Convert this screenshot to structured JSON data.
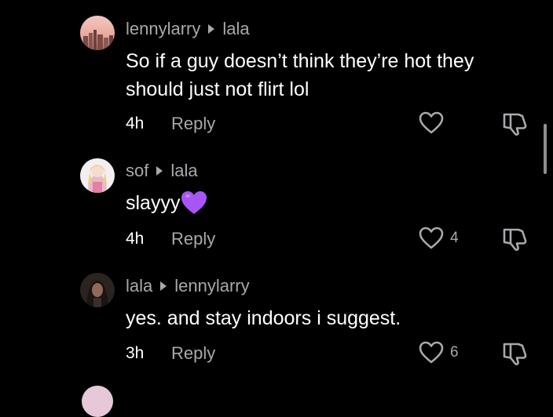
{
  "comments": [
    {
      "author": "lennylarry",
      "reply_to": "lala",
      "text_lines": [
        "So if a guy doesn’t think they’re hot they",
        "should just not flirt lol"
      ],
      "time": "4h",
      "reply_label": "Reply",
      "likes": "",
      "avatar_icon": "sunset-city-avatar"
    },
    {
      "author": "sof",
      "reply_to": "lala",
      "text_lines": [
        "slayyy"
      ],
      "emoji": "purple-heart-emoji",
      "time": "4h",
      "reply_label": "Reply",
      "likes": "4",
      "avatar_icon": "anime-girl-avatar"
    },
    {
      "author": "lala",
      "reply_to": "lennylarry",
      "text_lines": [
        "yes. and stay indoors i suggest."
      ],
      "time": "3h",
      "reply_label": "Reply",
      "likes": "6",
      "avatar_icon": "dark-portrait-avatar"
    }
  ],
  "colors": {
    "background": "#000000",
    "muted_text": "#a8a8ad",
    "primary_text": "#ffffff",
    "emoji_purple": "#a855f7"
  }
}
